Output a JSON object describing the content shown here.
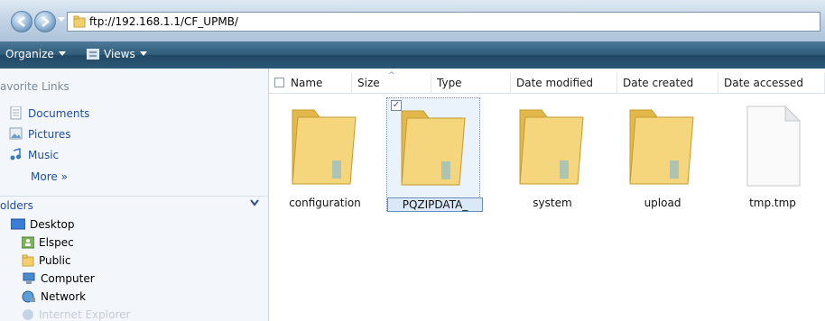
{
  "address": {
    "path": "ftp://192.168.1.1/CF_UPMB/"
  },
  "toolbar": {
    "organize": "Organize",
    "views": "Views"
  },
  "left": {
    "favorites_header": "avorite Links",
    "favorites": [
      {
        "label": "Documents",
        "icon": "document-icon"
      },
      {
        "label": "Pictures",
        "icon": "pictures-icon"
      },
      {
        "label": "Music",
        "icon": "music-icon"
      }
    ],
    "more": "More  »",
    "folders_header": "olders",
    "tree": [
      {
        "label": "Desktop",
        "icon": "desktop-icon"
      },
      {
        "label": "Elspec",
        "icon": "user-folder-icon"
      },
      {
        "label": "Public",
        "icon": "folder-icon"
      },
      {
        "label": "Computer",
        "icon": "computer-icon"
      },
      {
        "label": "Network",
        "icon": "network-icon"
      },
      {
        "label": "Internet Explorer",
        "icon": "ie-icon"
      }
    ]
  },
  "columns": [
    "Name",
    "Size",
    "Type",
    "Date modified",
    "Date created",
    "Date accessed"
  ],
  "items": [
    {
      "name": "configuration",
      "kind": "folder",
      "selected": false
    },
    {
      "name": "PQZIPDATA_",
      "kind": "folder",
      "selected": true
    },
    {
      "name": "system",
      "kind": "folder",
      "selected": false
    },
    {
      "name": "upload",
      "kind": "folder",
      "selected": false
    },
    {
      "name": "tmp.tmp",
      "kind": "file",
      "selected": false
    }
  ],
  "colors": {
    "toolbar": "#2f5a78",
    "link": "#1f4ea0",
    "folder": "#f2cf6a",
    "selection": "#dbe8f7"
  }
}
